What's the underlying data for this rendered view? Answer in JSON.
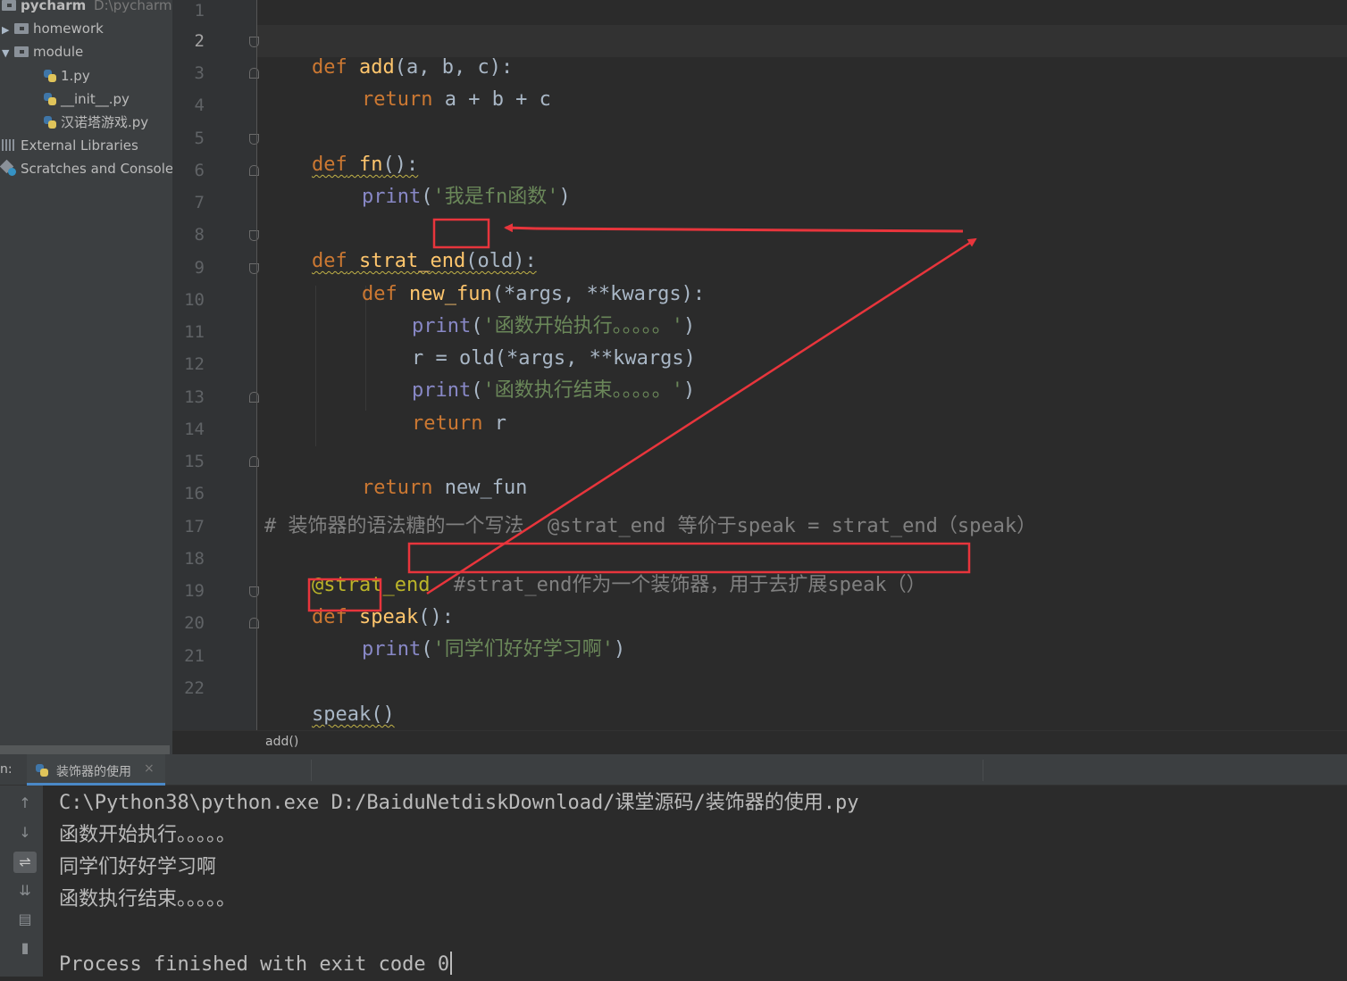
{
  "project": {
    "root_name": "pycharm",
    "root_path": "D:\\pycharm",
    "items": [
      {
        "label": "homework",
        "kind": "folder",
        "expanded": false
      },
      {
        "label": "module",
        "kind": "folder",
        "expanded": true
      },
      {
        "label": "1.py",
        "kind": "python-file"
      },
      {
        "label": "__init__.py",
        "kind": "python-file"
      },
      {
        "label": "汉诺塔游戏.py",
        "kind": "python-file"
      },
      {
        "label": "External Libraries",
        "kind": "library"
      },
      {
        "label": "Scratches and Consoles",
        "kind": "scratches"
      }
    ]
  },
  "editor": {
    "line_numbers": [
      "1",
      "2",
      "3",
      "4",
      "5",
      "6",
      "7",
      "8",
      "9",
      "10",
      "11",
      "12",
      "13",
      "14",
      "15",
      "16",
      "17",
      "18",
      "19",
      "20",
      "21",
      "22"
    ],
    "current_line": "2",
    "breadcrumb": "add()",
    "code": {
      "l2": {
        "def": "def",
        "name": "add",
        "rest": "(a, b, c):"
      },
      "l3": {
        "kw": "return",
        "rest": " a + b + c"
      },
      "l5": {
        "def": "def",
        "name": "fn",
        "rest": "():"
      },
      "l6": {
        "bi": "print",
        "open": "(",
        "str": "'我是fn函数'",
        "close": ")"
      },
      "l8": {
        "def": "def",
        "name": "strat_end",
        "open": "(",
        "param": "old",
        "close": "):"
      },
      "l9": {
        "def": "def",
        "name": "new_fun",
        "rest": "(*args, **kwargs):"
      },
      "l10": {
        "bi": "print",
        "open": "(",
        "str": "'函数开始执行。。。。。'",
        "close": ")"
      },
      "l11": {
        "rest": "r = old(*args, **kwargs)"
      },
      "l12": {
        "bi": "print",
        "open": "(",
        "str": "'函数执行结束。。。。。'",
        "close": ")"
      },
      "l13": {
        "kw": "return",
        "rest": " r"
      },
      "l15": {
        "kw": "return",
        "rest": " new_fun"
      },
      "l17": {
        "comment": "# 装饰器的语法糖的一个写法  @strat_end 等价于speak = strat_end（speak）"
      },
      "l18": {
        "decorator": "@strat_end",
        "comment": "  #strat_end作为一个装饰器，用于去扩展speak（）"
      },
      "l19": {
        "def": "def",
        "name": "speak",
        "rest": "():"
      },
      "l20": {
        "bi": "print",
        "open": "(",
        "str": "'同学们好好学习啊'",
        "close": ")"
      },
      "l22": {
        "call": "speak()"
      }
    }
  },
  "run": {
    "label": "n:",
    "tab_label": "装饰器的使用",
    "tab_close": "×",
    "toolbar": [
      "up-arrow-icon",
      "down-arrow-icon",
      "soft-wrap-icon",
      "scroll-to-end-icon",
      "print-icon",
      "trash-icon"
    ],
    "console_lines": [
      "C:\\Python38\\python.exe D:/BaiduNetdiskDownload/课堂源码/装饰器的使用.py",
      "函数开始执行。。。。。",
      "同学们好好学习啊",
      "函数执行结束。。。。。",
      "",
      "Process finished with exit code 0"
    ]
  },
  "colors": {
    "keyword": "#cc7832",
    "function_name": "#ffc66d",
    "string": "#6a8759",
    "builtin": "#8888c6",
    "comment": "#808080",
    "decorator": "#bbb529",
    "annotation_red": "#e8353c"
  }
}
